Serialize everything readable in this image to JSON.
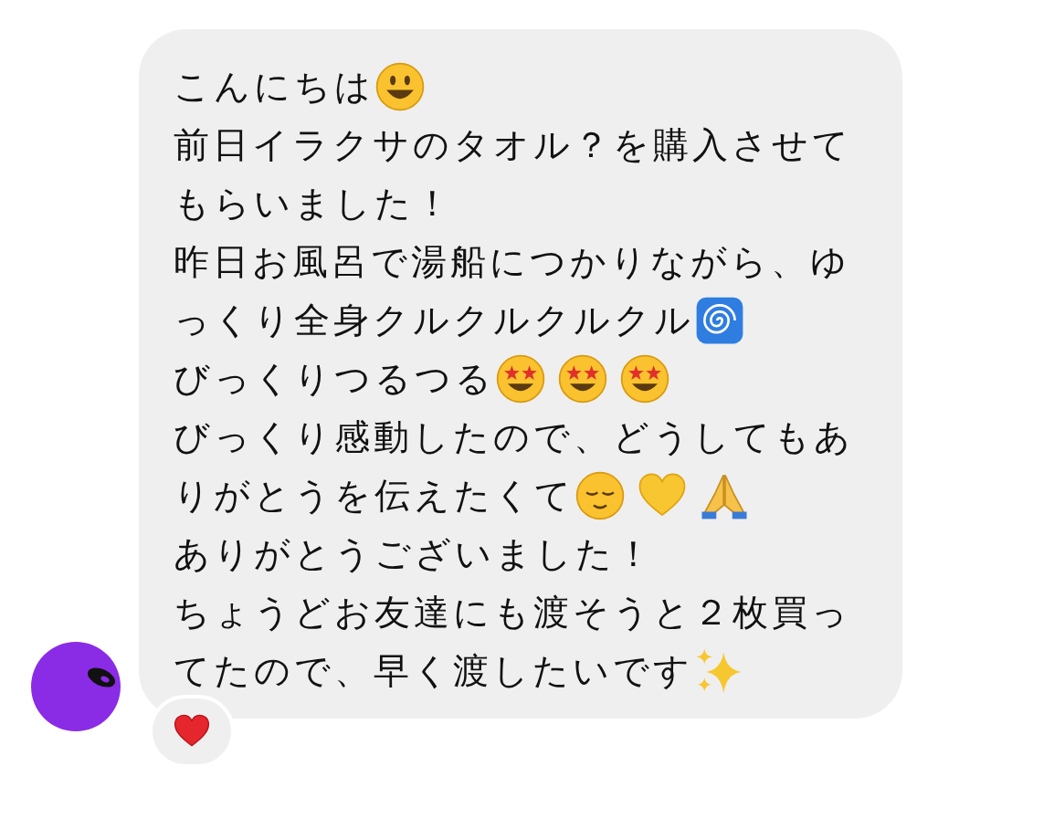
{
  "message": {
    "lines": [
      [
        {
          "kind": "text",
          "text": "こんにちは"
        },
        {
          "kind": "smile"
        }
      ],
      [
        {
          "kind": "text",
          "text": "前日イラクサのタオル？を購入させて"
        }
      ],
      [
        {
          "kind": "text",
          "text": "もらいました！"
        }
      ],
      [
        {
          "kind": "text",
          "text": "昨日お風呂で湯船につかりながら、ゆ"
        }
      ],
      [
        {
          "kind": "text",
          "text": "っくり全身クルクルクルクル"
        },
        {
          "kind": "spiral"
        }
      ],
      [
        {
          "kind": "text",
          "text": "びっくりつるつる"
        },
        {
          "kind": "stareyes"
        },
        {
          "kind": "stareyes"
        },
        {
          "kind": "stareyes"
        }
      ],
      [
        {
          "kind": "text",
          "text": "びっくり感動したので、どうしてもあ"
        }
      ],
      [
        {
          "kind": "text",
          "text": "りがとうを伝えたくて"
        },
        {
          "kind": "relieved"
        },
        {
          "kind": "yellowheart"
        },
        {
          "kind": "hands"
        }
      ],
      [
        {
          "kind": "text",
          "text": "ありがとうございました！"
        }
      ],
      [
        {
          "kind": "text",
          "text": "ちょうどお友達にも渡そうと２枚買っ"
        }
      ],
      [
        {
          "kind": "text",
          "text": "てたので、早く渡したいです"
        },
        {
          "kind": "sparkles"
        }
      ]
    ],
    "reaction": {
      "kind": "redheart"
    }
  }
}
